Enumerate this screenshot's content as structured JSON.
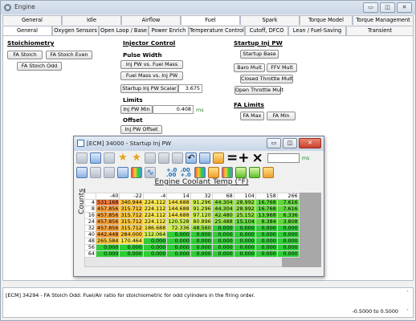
{
  "window": {
    "title": "Engine",
    "min_glyph": "▭",
    "restore_glyph": "◫",
    "close_glyph": "✕"
  },
  "tabs_row1": [
    "General",
    "Idle",
    "Airflow",
    "Fuel",
    "Spark",
    "Torque Model",
    "Torque Management"
  ],
  "tabs_row2": [
    "General",
    "Oxygen Sensors",
    "Open Loop / Base",
    "Power Enrich",
    "Temperature Control",
    "Cutoff, DFCO",
    "Lean / Fuel-Saving",
    "Transient"
  ],
  "stoich": {
    "title": "Stoichiometry",
    "buttons": [
      "FA Stoich",
      "FA Stoich Even",
      "FA Stoich Odd"
    ]
  },
  "injector": {
    "title": "Injector Control",
    "pulse_width": "Pulse Width",
    "btn_pw_mass": "Inj PW vs. Fuel Mass",
    "btn_mass_pw": "Fuel Mass vs. Inj PW",
    "scalar_label": "Startup Inj PW Scalar",
    "scalar_value": "3.675",
    "limits": "Limits",
    "pw_min_label": "Inj PW Min",
    "pw_min_value": "0.408",
    "pw_min_unit": "ms",
    "offset": "Offset",
    "btn_offset": "Inj PW Offset"
  },
  "startup": {
    "title": "Startup Inj PW",
    "btn_base": "Startup Base",
    "btn_baro": "Baro Mult",
    "btn_ffv": "FFV Mult",
    "btn_closed": "Closed Throttle Mult",
    "btn_open": "Open Throttle Mult"
  },
  "fa_limits": {
    "title": "FA Limits",
    "btn_max": "FA Max",
    "btn_min": "FA Min"
  },
  "table_window": {
    "title": "[ECM] 34000 - Startup Inj PW",
    "unit": "ms",
    "col_axis": "Engine Coolant Temp (°F)",
    "row_axis": "Counts",
    "min_glyph": "▭",
    "restore_glyph": "◫",
    "close_glyph": "✕",
    "sym_plus": "=+",
    "sym_times": "×",
    "dec_glyph_1": "+.0\n.00",
    "dec_glyph_2": ".00\n+.0",
    "star_glyph": "★",
    "undo_glyph": "↶",
    "trend_glyph": "∿",
    "col_headers": [
      "-40",
      "-22",
      "-4",
      "14",
      "32",
      "68",
      "104",
      "158",
      "266"
    ],
    "rows": [
      {
        "h": "4",
        "v": [
          "531.168",
          "340.944",
          "224.112",
          "144.688",
          "91.296",
          "44.304",
          "28.992",
          "16.768",
          "7.616"
        ]
      },
      {
        "h": "8",
        "v": [
          "457.856",
          "315.712",
          "224.112",
          "144.688",
          "91.296",
          "44.304",
          "28.992",
          "16.768",
          "7.616"
        ]
      },
      {
        "h": "16",
        "v": [
          "457.856",
          "315.712",
          "224.112",
          "144.688",
          "97.120",
          "42.480",
          "25.152",
          "13.968",
          "6.336"
        ]
      },
      {
        "h": "24",
        "v": [
          "457.856",
          "315.712",
          "224.112",
          "120.528",
          "80.896",
          "25.488",
          "15.104",
          "8.384",
          "3.808"
        ]
      },
      {
        "h": "32",
        "v": [
          "457.856",
          "315.712",
          "186.688",
          "72.336",
          "48.560",
          "0.000",
          "0.000",
          "0.000",
          "0.000"
        ]
      },
      {
        "h": "40",
        "v": [
          "442.448",
          "284.000",
          "112.064",
          "0.000",
          "0.000",
          "0.000",
          "0.000",
          "0.000",
          "0.000"
        ]
      },
      {
        "h": "48",
        "v": [
          "265.584",
          "170.464",
          "0.000",
          "0.000",
          "0.000",
          "0.000",
          "0.000",
          "0.000",
          "0.000"
        ]
      },
      {
        "h": "56",
        "v": [
          "0.000",
          "0.000",
          "0.000",
          "0.000",
          "0.000",
          "0.000",
          "0.000",
          "0.000",
          "0.000"
        ]
      },
      {
        "h": "64",
        "v": [
          "0.000",
          "0.000",
          "0.000",
          "0.000",
          "0.000",
          "0.000",
          "0.000",
          "0.000",
          "0.000"
        ]
      }
    ]
  },
  "status": {
    "message": "[ECM] 34294 - FA Stoich Odd: Fuel/Air ratio for stoichiometric for odd cylinders in the firing order.",
    "range": "-0.5000 to 0.5000",
    "scroll_up": "˄",
    "scroll_down": "˅"
  }
}
